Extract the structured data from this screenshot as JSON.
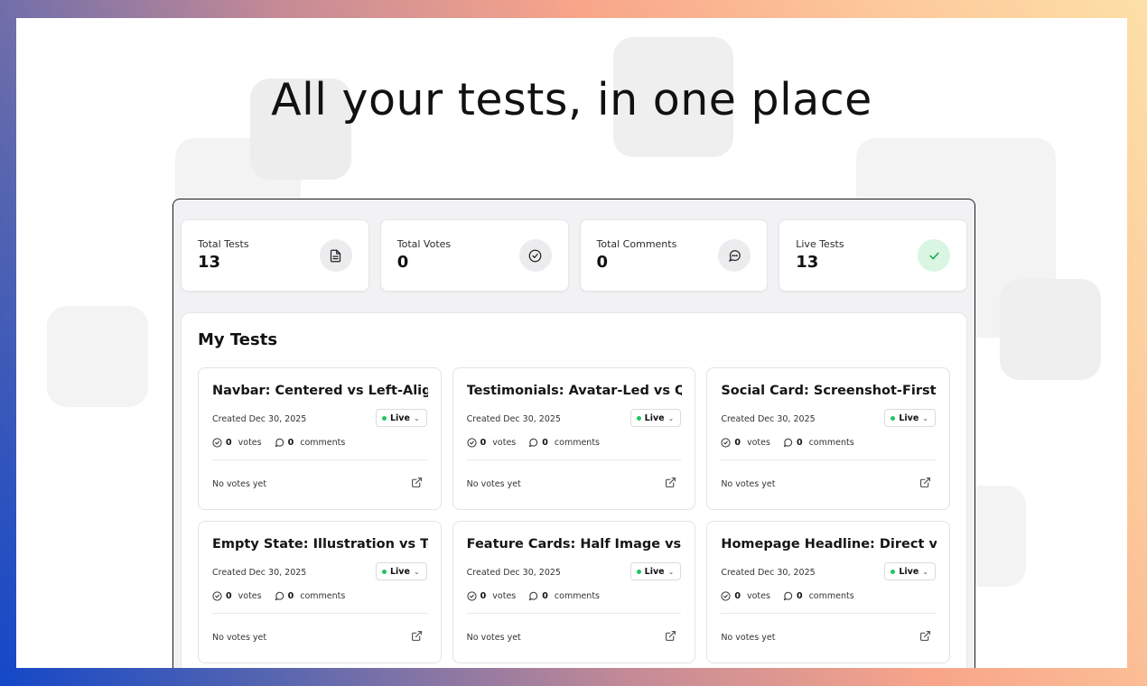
{
  "hero": {
    "headline": "All your tests, in one place"
  },
  "stats": [
    {
      "label": "Total Tests",
      "value": "13",
      "icon": "document-icon"
    },
    {
      "label": "Total Votes",
      "value": "0",
      "icon": "check-circle-icon"
    },
    {
      "label": "Total Comments",
      "value": "0",
      "icon": "comment-icon"
    },
    {
      "label": "Live Tests",
      "value": "13",
      "icon": "check-icon"
    }
  ],
  "my_tests": {
    "title": "My Tests",
    "cards": [
      {
        "title": "Navbar: Centered vs Left-Aligned",
        "date": "Created Dec 30, 2025",
        "status": "Live",
        "votes": "0",
        "votes_label": "votes",
        "comments": "0",
        "comments_label": "comments",
        "footer": "No votes yet"
      },
      {
        "title": "Testimonials: Avatar-Led vs Quote-Led",
        "date": "Created Dec 30, 2025",
        "status": "Live",
        "votes": "0",
        "votes_label": "votes",
        "comments": "0",
        "comments_label": "comments",
        "footer": "No votes yet"
      },
      {
        "title": "Social Card: Screenshot-First vs Text-First",
        "date": "Created Dec 30, 2025",
        "status": "Live",
        "votes": "0",
        "votes_label": "votes",
        "comments": "0",
        "comments_label": "comments",
        "footer": "No votes yet"
      },
      {
        "title": "Empty State: Illustration vs Text-Only",
        "date": "Created Dec 30, 2025",
        "status": "Live",
        "votes": "0",
        "votes_label": "votes",
        "comments": "0",
        "comments_label": "comments",
        "footer": "No votes yet"
      },
      {
        "title": "Feature Cards: Half Image vs Full Image",
        "date": "Created Dec 30, 2025",
        "status": "Live",
        "votes": "0",
        "votes_label": "votes",
        "comments": "0",
        "comments_label": "comments",
        "footer": "No votes yet"
      },
      {
        "title": "Homepage Headline: Direct vs Benefit",
        "date": "Created Dec 30, 2025",
        "status": "Live",
        "votes": "0",
        "votes_label": "votes",
        "comments": "0",
        "comments_label": "comments",
        "footer": "No votes yet"
      }
    ]
  },
  "colors": {
    "live_dot": "#22c55e",
    "live_badge_bg": "#d8f6e1",
    "live_check": "#16a34a"
  }
}
